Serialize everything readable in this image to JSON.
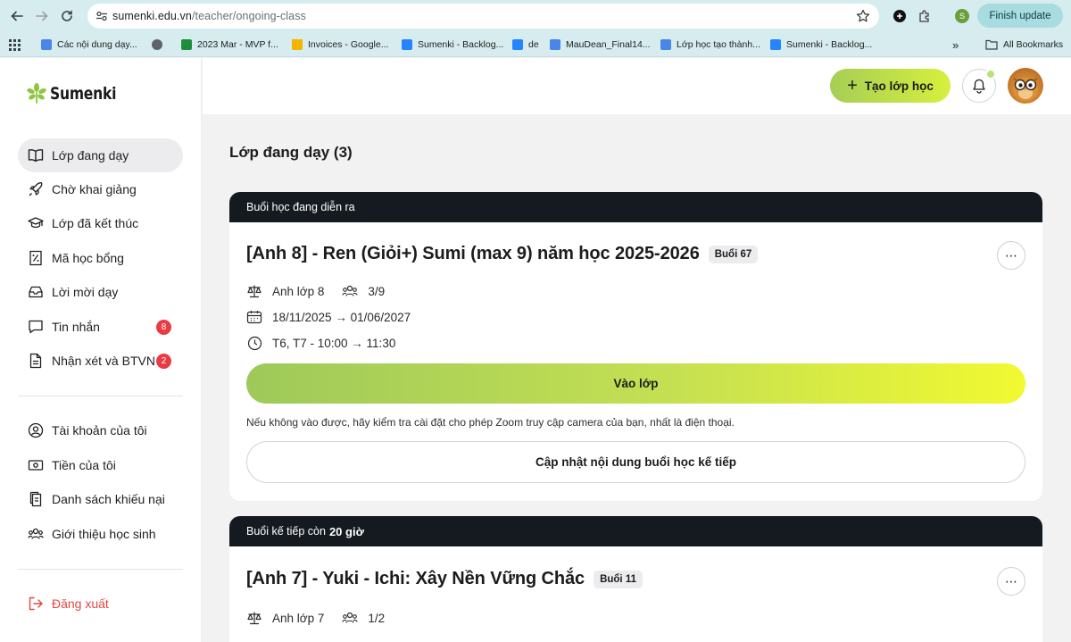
{
  "browser": {
    "url_host": "sumenki.edu.vn",
    "url_path": "/teacher/ongoing-class",
    "profile_initial": "S",
    "finish_update_label": "Finish update",
    "bookmarks": [
      {
        "label": "Các nội dung dạy...",
        "color": "#4a86e8"
      },
      {
        "label": "",
        "color": "#5f6368"
      },
      {
        "label": "2023 Mar - MVP f...",
        "color": "#1e8e3e"
      },
      {
        "label": "Invoices - Google...",
        "color": "#f4b400"
      },
      {
        "label": "Sumenki - Backlog...",
        "color": "#2684ff"
      },
      {
        "label": "de",
        "color": "#2684ff"
      },
      {
        "label": "MauDean_Final14...",
        "color": "#4a86e8"
      },
      {
        "label": "Lớp học tạo thành...",
        "color": "#4a86e8"
      },
      {
        "label": "Sumenki - Backlog...",
        "color": "#2684ff"
      }
    ],
    "more_bookmarks": "»",
    "all_bookmarks_label": "All Bookmarks"
  },
  "brand": {
    "name": "Sumenki",
    "accent": "#8cc63f"
  },
  "sidebar": {
    "items": [
      {
        "label": "Lớp đang dạy",
        "icon": "book-open-icon",
        "active": true
      },
      {
        "label": "Chờ khai giảng",
        "icon": "rocket-icon"
      },
      {
        "label": "Lớp đã kết thúc",
        "icon": "graduation-cap-icon"
      },
      {
        "label": "Mã học bổng",
        "icon": "coupon-icon"
      },
      {
        "label": "Lời mời dạy",
        "icon": "inbox-icon"
      },
      {
        "label": "Tin nhắn",
        "icon": "message-icon",
        "badge": "8"
      },
      {
        "label": "Nhận xét và BTVN",
        "icon": "document-icon",
        "badge": "2"
      }
    ],
    "account_items": [
      {
        "label": "Tài khoản của tôi",
        "icon": "user-circle-icon"
      },
      {
        "label": "Tiền của tôi",
        "icon": "money-icon"
      },
      {
        "label": "Danh sách khiếu nại",
        "icon": "complaint-icon"
      },
      {
        "label": "Giới thiệu học sinh",
        "icon": "users-icon"
      }
    ],
    "logout_label": "Đăng xuất"
  },
  "header": {
    "create_class_label": "Tạo lớp học"
  },
  "main": {
    "title": "Lớp đang dạy (3)",
    "classes": [
      {
        "status_text": "Buổi học đang diễn ra",
        "title": "[Anh 8] - Ren (Giỏi+) Sumi (max 9) năm học 2025-2026",
        "session": "Buổi 67",
        "subject": "Anh lớp 8",
        "students": "3/9",
        "date_range": "18/11/2025 → 01/06/2027",
        "schedule": "T6, T7 - 10:00 → 11:30",
        "join_label": "Vào lớp",
        "hint": "Nếu không vào được, hãy kiểm tra cài đặt cho phép Zoom truy cập camera của bạn, nhất là điện thoại.",
        "update_label": "Cập nhật nội dung buổi học kế tiếp"
      },
      {
        "status_prefix": "Buổi kế tiếp còn",
        "status_time": "20 giờ",
        "title": "[Anh 7] - Yuki - Ichi: Xây Nền Vững Chắc",
        "session": "Buổi 11",
        "subject": "Anh lớp 7",
        "students": "1/2"
      }
    ]
  }
}
